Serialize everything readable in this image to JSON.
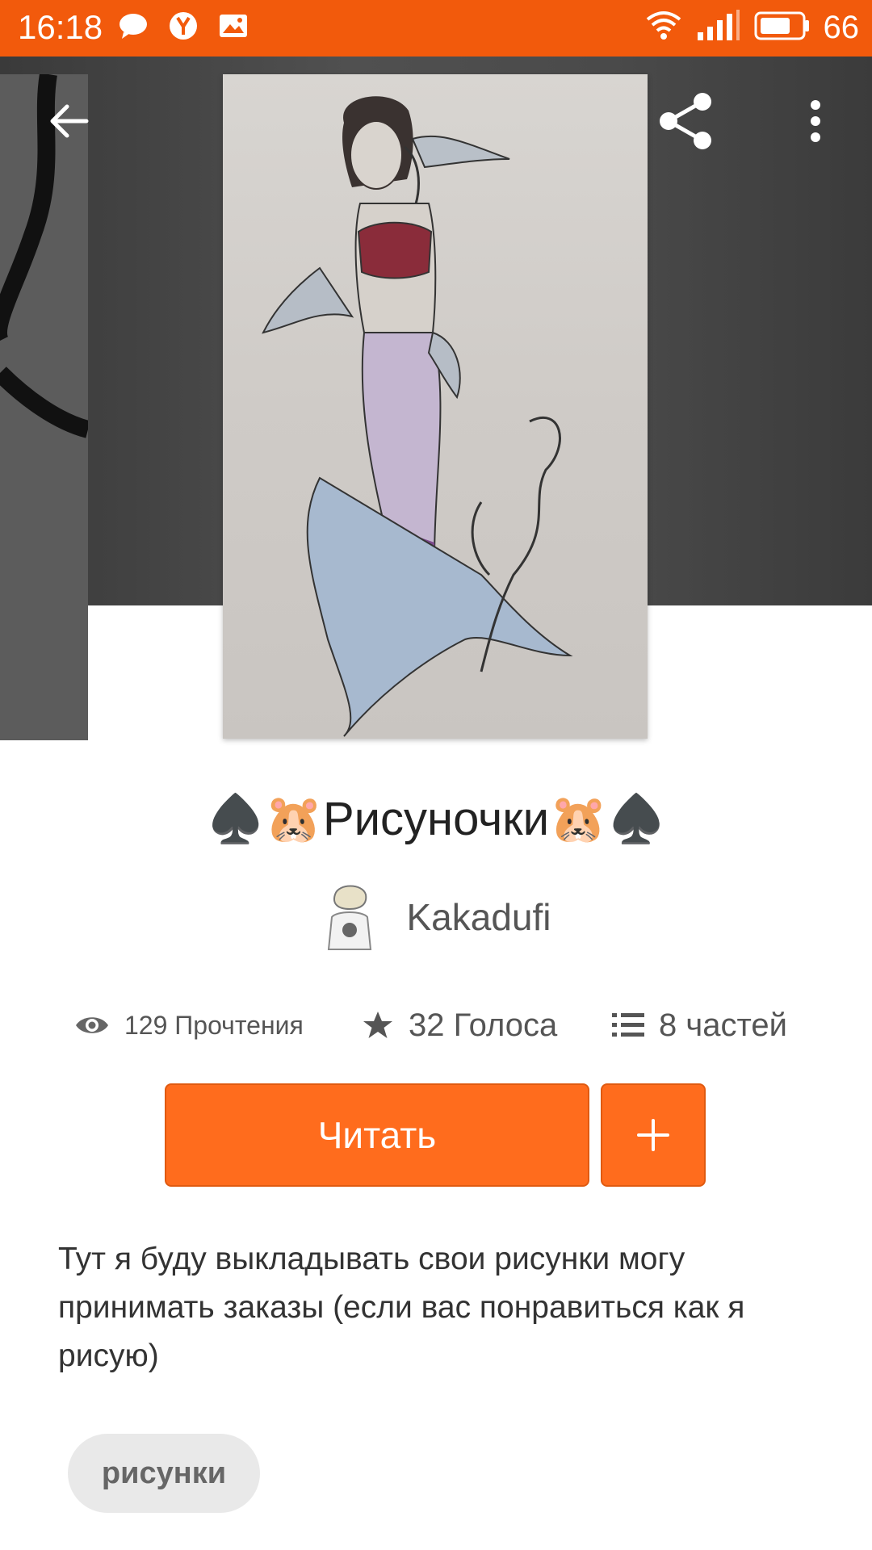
{
  "status_bar": {
    "time": "16:18",
    "battery_level": "66",
    "icons": [
      "message-icon",
      "yandex-icon",
      "gallery-icon",
      "wifi-icon",
      "signal-icon",
      "battery-icon"
    ],
    "background_color": "#f25a0c"
  },
  "toolbar": {
    "back_icon": "arrow-left-icon",
    "share_icon": "share-icon",
    "more_icon": "more-vertical-icon"
  },
  "story": {
    "title": "♠️🐹Рисуночки🐹♠️",
    "author": "Kakadufi",
    "stats": {
      "reads": "129 Прочтения",
      "votes": "32 Голоса",
      "parts": "8 частей"
    },
    "read_label": "Читать",
    "add_label": "+",
    "description": "Тут я буду выкладывать свои рисунки могу принимать заказы (если вас понравиться как я рисую)",
    "tags": [
      "рисунки"
    ]
  },
  "colors": {
    "accent": "#ff6c1d",
    "hero_background": "#4a4a4a",
    "tag_background": "#e9e9e9"
  }
}
